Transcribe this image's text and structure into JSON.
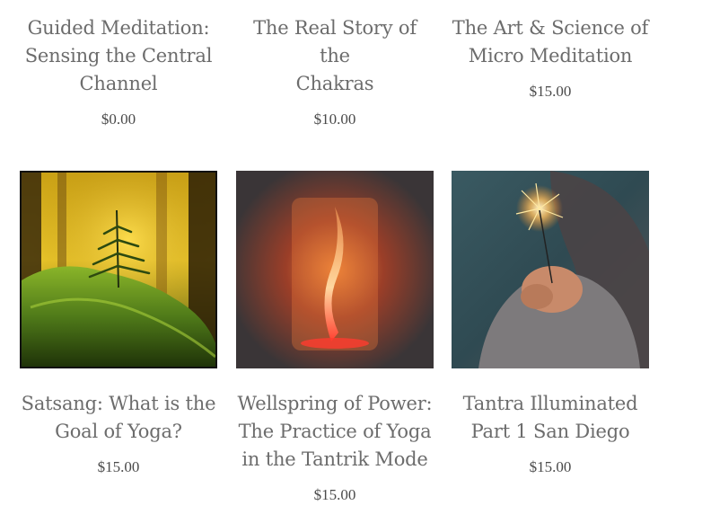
{
  "products_top": [
    {
      "title_lines": [
        "Guided Meditation:",
        "Sensing the Central",
        "Channel"
      ],
      "price": "$0.00"
    },
    {
      "title_lines": [
        "The Real Story of the",
        "Chakras"
      ],
      "price": "$10.00"
    },
    {
      "title_lines": [
        "The Art & Science of",
        "Micro Meditation"
      ],
      "price": "$15.00"
    }
  ],
  "products_bottom": [
    {
      "title_lines": [
        "Satsang: What is the",
        "Goal of Yoga?"
      ],
      "price": "$15.00",
      "image_icon": "forest-tree-image"
    },
    {
      "title_lines": [
        "Wellspring of Power:",
        "The Practice of Yoga",
        "in the Tantrik Mode"
      ],
      "price": "$15.00",
      "image_icon": "flame-light-image"
    },
    {
      "title_lines": [
        "Tantra Illuminated",
        "Part 1 San Diego"
      ],
      "price": "$15.00",
      "image_icon": "sparkler-hands-image"
    }
  ]
}
